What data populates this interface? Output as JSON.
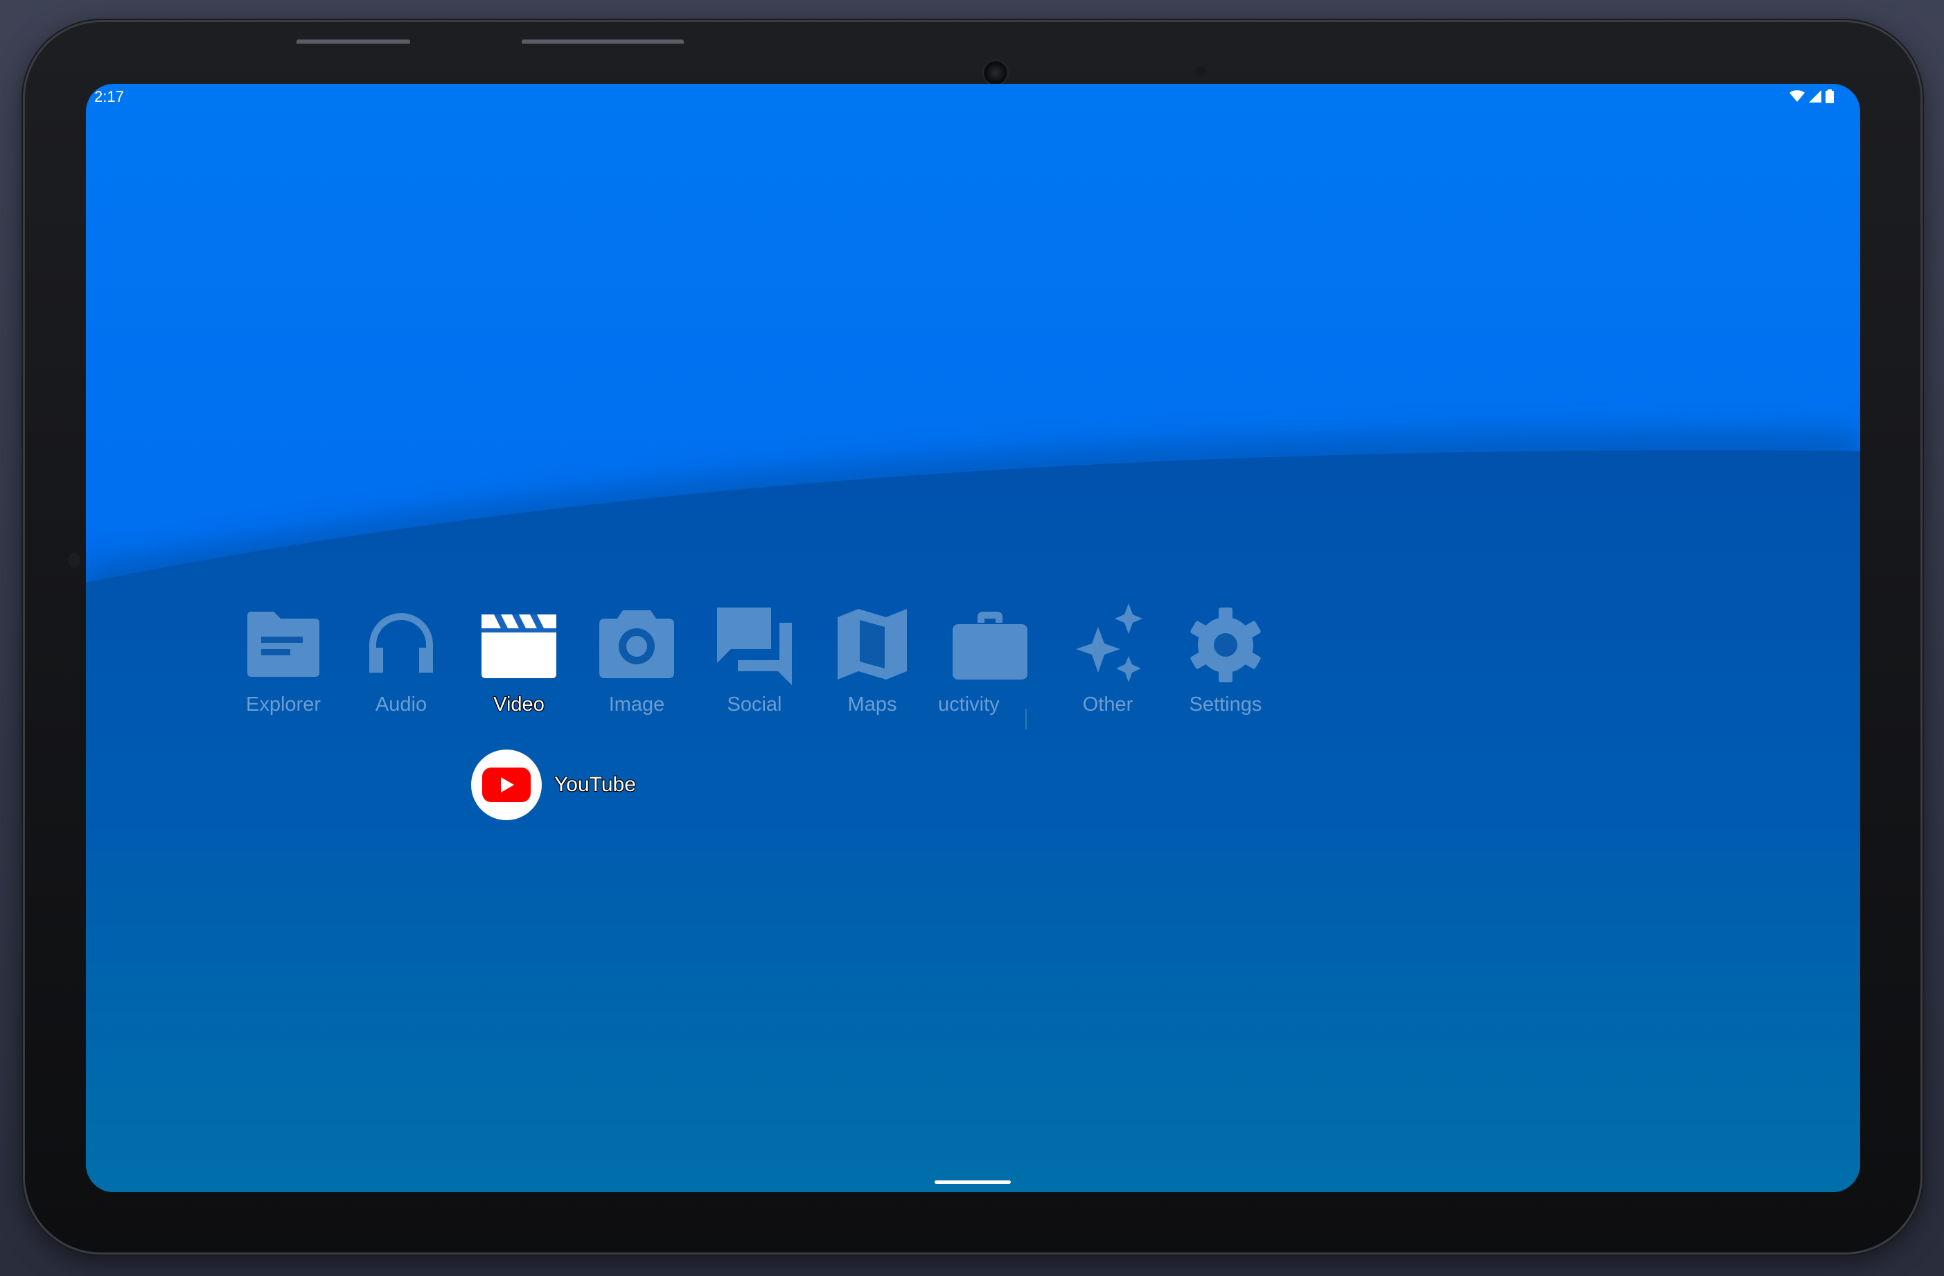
{
  "status_bar": {
    "time": "2:17",
    "icons": [
      "wifi-icon",
      "cell-signal-icon",
      "battery-icon"
    ]
  },
  "categories": [
    {
      "label": "Explorer",
      "icon": "folder-icon",
      "active": false
    },
    {
      "label": "Audio",
      "icon": "headphones-icon",
      "active": false
    },
    {
      "label": "Video",
      "icon": "clapperboard-icon",
      "active": true
    },
    {
      "label": "Image",
      "icon": "camera-icon",
      "active": false
    },
    {
      "label": "Social",
      "icon": "chat-bubbles-icon",
      "active": false
    },
    {
      "label": "Maps",
      "icon": "map-icon",
      "active": false
    },
    {
      "label": "uctivity",
      "icon": "briefcase-icon",
      "active": false
    },
    {
      "label": "Other",
      "icon": "sparkles-icon",
      "active": false
    },
    {
      "label": "Settings",
      "icon": "gear-icon",
      "active": false
    }
  ],
  "apps": [
    {
      "label": "YouTube",
      "icon": "youtube-icon"
    }
  ],
  "colors": {
    "screen_top": "#0077f2",
    "screen_bottom": "#0071a8",
    "icon_inactive": "#c3d7f0",
    "icon_active": "#ffffff",
    "youtube_red": "#ff0000"
  }
}
